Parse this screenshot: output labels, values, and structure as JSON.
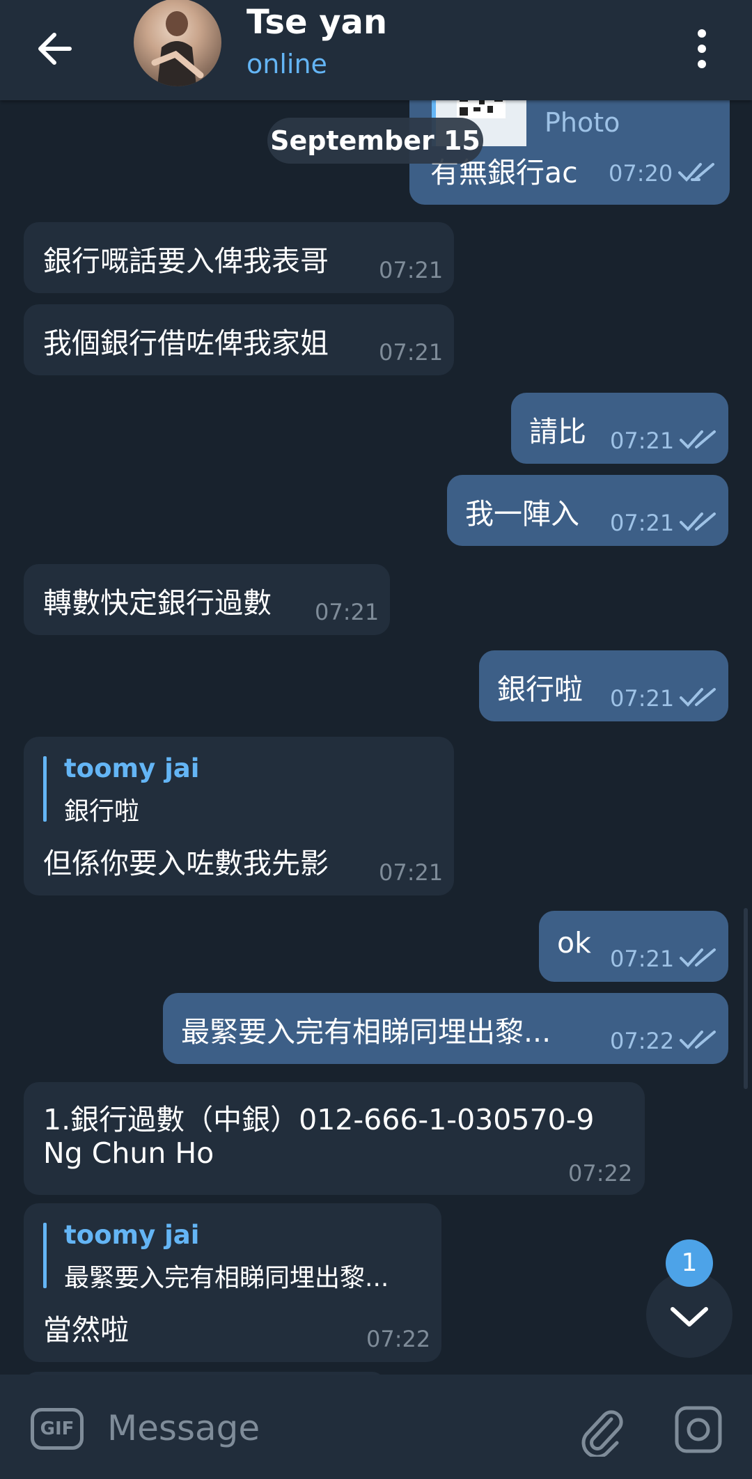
{
  "header": {
    "title": "Tse yan",
    "status": "online"
  },
  "chat": {
    "date_chip": "September 15",
    "photo_caption": "Photo",
    "messages": [
      {
        "dir": "out",
        "text": "有無銀行ac",
        "time": "07:20"
      },
      {
        "dir": "in",
        "text": "銀行嘅話要入俾我表哥",
        "time": "07:21"
      },
      {
        "dir": "in",
        "text": "我個銀行借咗俾我家姐",
        "time": "07:21"
      },
      {
        "dir": "out",
        "text": "請比",
        "time": "07:21"
      },
      {
        "dir": "out",
        "text": "我一陣入",
        "time": "07:21"
      },
      {
        "dir": "in",
        "text": "轉數快定銀行過數",
        "time": "07:21"
      },
      {
        "dir": "out",
        "text": "銀行啦",
        "time": "07:21"
      },
      {
        "dir": "in",
        "reply_name": "toomy jai",
        "reply_text": "銀行啦",
        "text": "但係你要入咗數我先影",
        "time": "07:21"
      },
      {
        "dir": "out",
        "text": "ok",
        "time": "07:21"
      },
      {
        "dir": "out",
        "text": "最緊要入完有相睇同埋出黎...",
        "time": "07:22"
      },
      {
        "dir": "in",
        "text": "1.銀行過數（中銀）012-666-1-030570-9",
        "text2": "Ng Chun Ho",
        "time": "07:22"
      },
      {
        "dir": "in",
        "reply_name": "toomy jai",
        "reply_text": "最緊要入完有相睇同埋出黎...",
        "text": "當然啦",
        "time": "07:22"
      }
    ]
  },
  "scroll_badge": "1",
  "input": {
    "placeholder": "Message",
    "gif_label": "GIF"
  },
  "colors": {
    "background": "#18222d",
    "header": "#212d3b",
    "incoming_bubble": "#222e3c",
    "outgoing_bubble": "#3d5f87",
    "accent": "#64b5f5"
  }
}
